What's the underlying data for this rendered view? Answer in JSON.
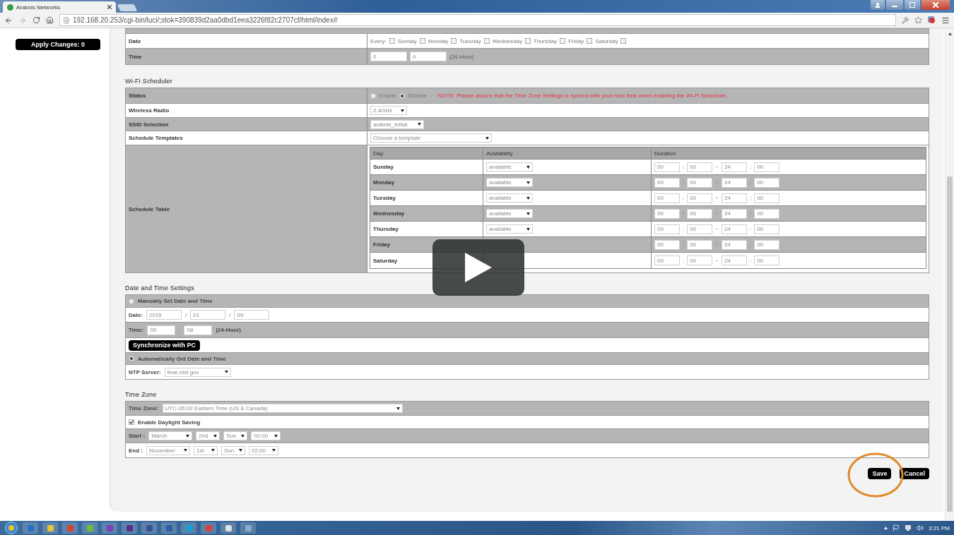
{
  "browser": {
    "tab_title": "Araknis Networks",
    "url": "192.168.20.253/cgi-bin/luci/;stok=390839d2aa0dbd1eea3226f82c2707cf/html/index#"
  },
  "sidebar": {
    "apply_button": "Apply Changes: 0"
  },
  "schedule_top": {
    "date": {
      "label": "Date",
      "every_label": "Every:",
      "every_checked": false,
      "days": [
        {
          "label": "Sunday",
          "checked": false
        },
        {
          "label": "Monday",
          "checked": false
        },
        {
          "label": "Tuesday",
          "checked": false
        },
        {
          "label": "Wednesday",
          "checked": false
        },
        {
          "label": "Thursday",
          "checked": false
        },
        {
          "label": "Friday",
          "checked": false
        },
        {
          "label": "Saturday",
          "checked": false
        }
      ]
    },
    "time": {
      "label": "Time",
      "fields": [
        "0",
        "0"
      ],
      "suffix": "(24-Hour)"
    }
  },
  "wifi_scheduler": {
    "title": "Wi-Fi Scheduler",
    "status": {
      "label": "Status",
      "options": [
        {
          "label": "Enable",
          "selected": false
        },
        {
          "label": "Disable",
          "selected": true
        }
      ],
      "note": "NOTE: Please assure that the Time Zone Settings is synced with your host time when enabling the Wi-Fi Scheduler."
    },
    "wireless_radio": {
      "label": "Wireless Radio",
      "value": "2.4GHz"
    },
    "ssid": {
      "label": "SSID Selection",
      "value": "araknis_initial"
    },
    "templates": {
      "label": "Schedule Templates",
      "placeholder": "Choose a template"
    },
    "schedule_table": {
      "label": "Schedule Table",
      "columns": [
        "Day",
        "Availability",
        "Duration"
      ],
      "rows": [
        {
          "day": "Sunday",
          "availability": "available",
          "duration": [
            "00",
            "00",
            "24",
            "00"
          ],
          "separators": [
            ":",
            "~",
            ":"
          ]
        },
        {
          "day": "Monday",
          "availability": "available",
          "duration": [
            "00",
            "00",
            "24",
            "00"
          ],
          "separators": [
            ":",
            "~",
            ":"
          ]
        },
        {
          "day": "Tuesday",
          "availability": "available",
          "duration": [
            "00",
            "00",
            "24",
            "00"
          ],
          "separators": [
            ":",
            "~",
            ":"
          ]
        },
        {
          "day": "Wednesday",
          "availability": "available",
          "duration": [
            "00",
            "00",
            "24",
            "00"
          ],
          "separators": [
            ":",
            "~",
            ":"
          ]
        },
        {
          "day": "Thursday",
          "availability": "available",
          "duration": [
            "00",
            "00",
            "24",
            "00"
          ],
          "separators": [
            ":",
            "~",
            ":"
          ]
        },
        {
          "day": "Friday",
          "duration": [
            "00",
            "00",
            "24",
            "00"
          ],
          "separators": [
            ":",
            "~",
            ":"
          ]
        },
        {
          "day": "Saturday",
          "duration": [
            "00",
            "00",
            "24",
            "00"
          ],
          "separators": [
            ":",
            "~",
            ":"
          ]
        }
      ]
    }
  },
  "date_time": {
    "title": "Date and Time Settings",
    "manual": {
      "label": "Manually Set Date and Time",
      "selected": false
    },
    "date": {
      "label": "Date:",
      "fields": [
        "2015",
        "01",
        "09"
      ],
      "separators": [
        "/",
        "/"
      ]
    },
    "time": {
      "label": "Time:",
      "fields": [
        "05",
        "08"
      ],
      "separators": [
        ":"
      ],
      "suffix": "(24-Hour)"
    },
    "sync_button": "Synchronize with PC",
    "auto": {
      "label": "Automatically Get Date and Time",
      "selected": true
    },
    "ntp": {
      "label": "NTP Server:",
      "value": "time.nist.gov"
    }
  },
  "time_zone": {
    "title": "Time Zone",
    "zone": {
      "label": "Time Zone:",
      "value": "UTC-05:00 Eastern Time (US & Canada)"
    },
    "daylight": {
      "label": "Enable Daylight Saving",
      "checked": true
    },
    "start": {
      "label": "Start :",
      "values": [
        "March",
        "2nd",
        "Sun",
        "02:00"
      ]
    },
    "end": {
      "label": "End :",
      "values": [
        "November",
        "1st",
        "Sun",
        "02:00"
      ]
    }
  },
  "buttons": {
    "save": "Save",
    "cancel": "Cancel"
  },
  "taskbar": {
    "clock": "3:21 PM"
  }
}
